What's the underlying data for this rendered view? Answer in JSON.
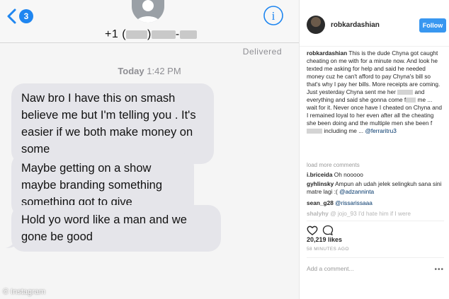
{
  "sms": {
    "badge": "3",
    "phone": {
      "prefix": "+1 (",
      "mid": ") ",
      "dash": "-"
    },
    "info_glyph": "i",
    "status": "Delivered",
    "timestamp_day": "Today",
    "timestamp_time": "1:42 PM",
    "messages": [
      "Naw bro I have this on smash believe me but I'm telling you . It's easier if we both make money on some",
      "Maybe getting on a show maybe branding something something got to give",
      "Hold yo word like a man and we gone be good"
    ],
    "bubble_color": "#e5e5ea",
    "accent": "#1f86f0",
    "watermark": "© Instagram"
  },
  "instagram": {
    "username": "robkardashian",
    "follow_label": "Follow",
    "caption": {
      "author": "robkardashian",
      "part1": "This is the dude Chyna got caught cheating on me with for a minute now. And look he texted me asking for help and said he needed money cuz he can't afford to pay Chyna's bill so that's why I pay her bills. More receipts are coming. Just yesterday Chyna sent me her",
      "part2": "and everything and said she gonna come f",
      "part3": "me ... wait for it. Never once have I cheated on Chyna and I remained loyal to her even after all the cheating she been doing and the multiple men she been f",
      "part4": "including me ...",
      "mention": "@ferraritru3"
    },
    "load_more": "load more comments",
    "comments": [
      {
        "user": "i.briceida",
        "text": "Oh nooooo",
        "mention": ""
      },
      {
        "user": "gyhlinsky",
        "text": "Ampun ah udah jelek selingkuh sana sini matre lagi :(",
        "mention": "@adzanninta"
      },
      {
        "user": "sean_g28",
        "text": "",
        "mention": "@rissarissaaa"
      },
      {
        "user": "shalyhy",
        "text": "@ jojo_93 I'd hate him if I were",
        "mention": ""
      }
    ],
    "likes": "20,219 likes",
    "posted_ago": "58 MINUTES AGO",
    "add_comment_placeholder": "Add a comment...",
    "more_glyph": "•••",
    "follow_color": "#3897f0"
  }
}
